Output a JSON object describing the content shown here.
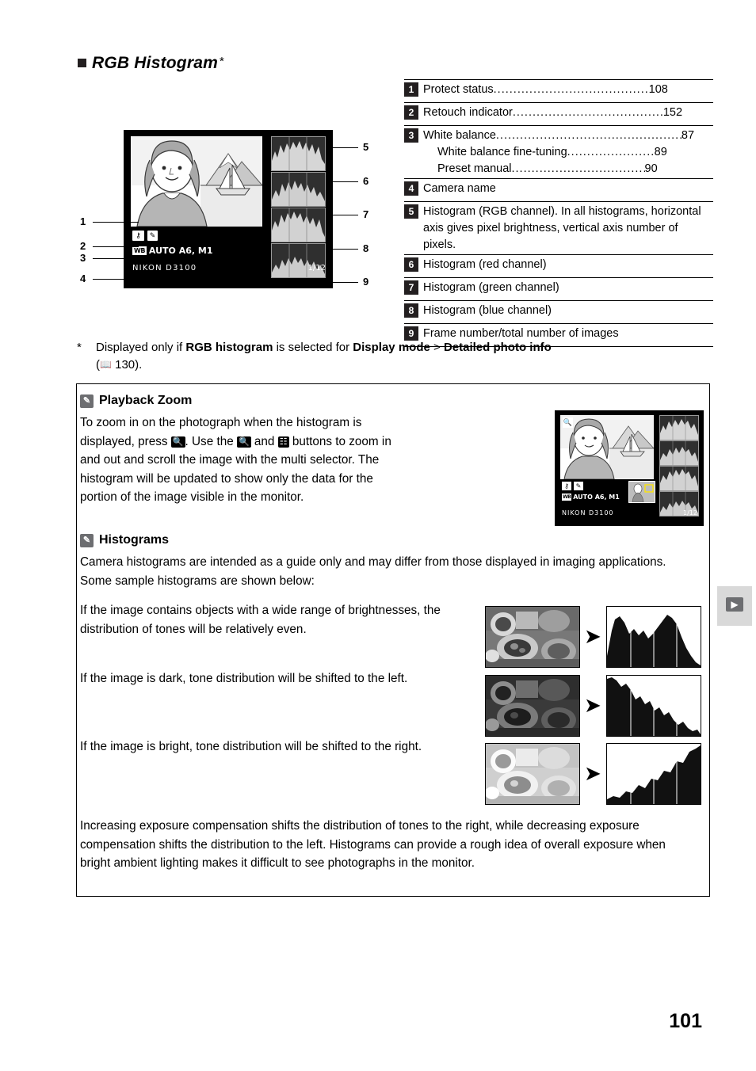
{
  "heading": {
    "title": "RGB Histogram",
    "star": "*"
  },
  "monitor": {
    "protect_icon": "key-icon",
    "retouch_icon": "retouch-icon",
    "wb_badge": "WB",
    "wb_text": "AUTO A6, M1",
    "camera_name": "NIKON D3100",
    "frame_number": "1/12",
    "callouts": [
      "1",
      "2",
      "3",
      "4",
      "5",
      "6",
      "7",
      "8",
      "9"
    ]
  },
  "legend": {
    "rows": [
      {
        "num": "1",
        "label": "Protect status",
        "page": "108"
      },
      {
        "num": "2",
        "label": "Retouch indicator",
        "page": "152"
      },
      {
        "num": "3",
        "label": "White balance",
        "page": "87",
        "sub": [
          {
            "label": "White balance fine-tuning",
            "page": "89"
          },
          {
            "label": "Preset manual",
            "page": "90"
          }
        ]
      },
      {
        "num": "4",
        "label": "Camera name",
        "page": ""
      },
      {
        "num": "5",
        "label": "Histogram (RGB channel).  In all histograms, horizontal axis gives pixel brightness, vertical axis number of pixels.",
        "page": ""
      },
      {
        "num": "6",
        "label": "Histogram (red channel)",
        "page": ""
      },
      {
        "num": "7",
        "label": "Histogram (green channel)",
        "page": ""
      },
      {
        "num": "8",
        "label": "Histogram (blue channel)",
        "page": ""
      },
      {
        "num": "9",
        "label": "Frame number/total number of images",
        "page": ""
      }
    ]
  },
  "footnote": {
    "star": "*",
    "part1": "Displayed only if ",
    "bold1": "RGB histogram",
    "part2": " is selected for ",
    "bold2": "Display mode",
    "part3": " > ",
    "bold3": "Detailed photo info",
    "part4": "(",
    "page_ref": "130",
    "part5": ").",
    "book_glyph": "book-icon"
  },
  "notes": {
    "playback_zoom": {
      "icon": "pencil-note-icon",
      "title": "Playback Zoom",
      "line1_a": "To zoom in on the photograph when the histogram is",
      "line2_a": "displayed, press ",
      "zoom_in_glyph": "zoom-in-button",
      "line2_b": ".  Use the ",
      "line2_c": " and ",
      "zoom_out_glyph": "zoom-out-button",
      "line2_d": " buttons to zoom in",
      "line3": "and out and scroll the image with the multi selector.  The",
      "line4": "histogram will be updated to show only the data for the",
      "line5": "portion of the image visible in the monitor."
    },
    "mini_monitor": {
      "zoom_icon": "magnifier-icon",
      "protect_icon": "key-icon",
      "retouch_icon": "retouch-icon",
      "wb_badge": "WB",
      "wb_text": "AUTO A6, M1",
      "camera_name": "NIKON D3100",
      "frame_number": "1/12"
    },
    "histograms": {
      "icon": "pencil-note-icon",
      "title": "Histograms",
      "intro": "Camera histograms are intended as a guide only and may differ from those displayed in imaging applications.  Some sample histograms are shown below:",
      "samples": [
        {
          "text": "If the image contains objects with a wide range of brightnesses, the distribution of tones will be relatively even.",
          "arrow": "arrow-right-icon"
        },
        {
          "text": "If the image is dark, tone distribution will be shifted to the left.",
          "arrow": "arrow-right-icon"
        },
        {
          "text": "If the image is bright, tone distribution will be shifted to the right.",
          "arrow": "arrow-right-icon"
        }
      ],
      "final": "Increasing exposure compensation shifts the distribution of tones to the right, while decreasing exposure compensation shifts the distribution to the left.  Histograms can provide a rough idea of overall exposure when bright ambient lighting makes it difficult to see photographs in the monitor."
    }
  },
  "side_tab": {
    "icon": "playback-icon"
  },
  "page_number": "101"
}
